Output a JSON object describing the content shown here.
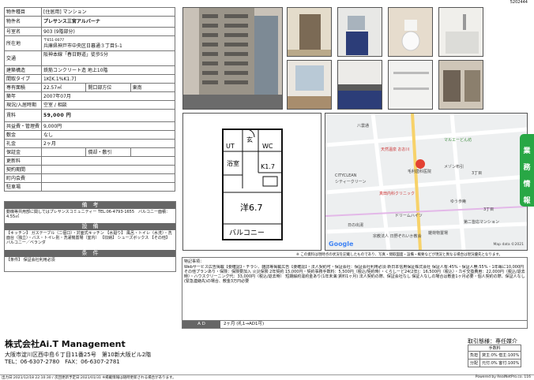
{
  "doc_id": "5202444",
  "spec": {
    "type_label": "物件種目",
    "type_value": "[住居用] マンション",
    "name_label": "物件名",
    "name_value": "プレサンス三宮アルバーナ",
    "room_label": "号室名",
    "room_value": "903 (9階部分)",
    "address_label": "所在地",
    "address_postal": "〒651-0077",
    "address_value": "兵庫県神戸市中央区日暮通３丁目5-1",
    "transport_label": "交通",
    "transport_value": "阪神本線「春日野道」徒歩5分",
    "structure_label": "建築構造",
    "structure_value": "鉄筋コンクリート造 地上10階",
    "layout_label": "間取タイプ",
    "layout_value": "1K[K.1%K1.7]",
    "area_label": "専有面積",
    "area_value": "22.57㎡",
    "direction_label": "開口部方位",
    "direction_value": "東南",
    "built_label": "築年",
    "built_value": "2007年07月",
    "status_label": "現況/入居時期",
    "status_value": "空室 / 相談",
    "rent_label": "賃料",
    "rent_value": "59,000 円",
    "fee_label": "共益費・管理費",
    "fee_value": "9,000円",
    "deposit_label": "敷金",
    "deposit_value": "なし",
    "key_money_label": "礼金",
    "key_money_value": "2ヶ月",
    "guarantee_label": "保証金",
    "guarantee_value": "",
    "amort_label": "償却・敷引",
    "amort_value": "",
    "renewal_label": "更新料",
    "renewal_value": "",
    "contract_label": "契約期間",
    "contract_value": "",
    "townfee_label": "町内会費",
    "townfee_value": "",
    "parking_label": "駐車場",
    "parking_value": ""
  },
  "remarks": {
    "title": "備　考",
    "text": "動機等共用部に関してはプレサンスコミュニティー TEL:06-4793-1655　バルコニー面積：4.55㎡"
  },
  "equipment": {
    "title": "設　備",
    "text": "【キッチン】 ガステーブル（二個口）・対面式キッチン 【水廻り】 風呂・トイレ（水洗）・洗面台（独立）・バス・トイレ別・洗濯機置場（室内） 【収納】 シューズボックス 【その他】 バルコニー／ベランダ"
  },
  "conditions": {
    "title": "条　件",
    "text": "【条件】 保証会社利用必須"
  },
  "floorplan": {
    "labels": [
      "玄",
      "UT",
      "WC",
      "浴室",
      "K1.7",
      "洋6.7",
      "バルコニー"
    ]
  },
  "map": {
    "labels": [
      "八雲通",
      "マルエーどん坊",
      "天然温泉 おお川",
      "メゾン布引",
      "3丁目",
      "CITYCLEAN",
      "シティークリーン",
      "毛利歯科医院",
      "真田内科クリニック",
      "ゆう歩庵",
      "第二皆応マンション",
      "ドリームハイツ",
      "日の出湯",
      "宗教法人 日野ぞれいか教会",
      "雑荷物置場",
      "3丁目",
      "Google",
      "Map data ©2021"
    ]
  },
  "map_note": "※ この資料は現時点の状況を記載したものであり、写真・間取図面・設備・概要などが現況と異なる場合は現況優先となります。",
  "special": {
    "label": "特記事項：",
    "text": "Webサービス広告掲載【要確認】・チラシ、雑誌等掲載広告【要確認】・法人契約可・保証会社：保証会社利用必須 新日本信用保証株式会社 保証人有:45%・保証人無:55%・1年毎に10,000円 その他プランあり・保険：保険要加入 火災保険 2年契約 15,000円・契約事務手数料：5,500円（税込/契約時）・くらしーど24(2年)：16,500円（税込）・カギ交換費用：22,000円（税込/退去時）・ハウスクリーニング代：33,000円（税込/退去時） 短期解約違約金あり(1年未満:賃料1ヶ月) 法人契約の際、保証会社なし 保証人なしの場合は敷金1ヶ月必要・個人契約の際、保証人なし(緊急連絡先)の場合、敷金3万円必要",
    "ad_label": "A D",
    "ad_value": "2ヶ月 (礼1→AD1可)"
  },
  "side_tab": [
    "業",
    "務",
    "情",
    "報"
  ],
  "company": {
    "name": "株式会社Ai.T Management",
    "address": "大阪市淀川区西中島６丁目11番25号　第10新大阪ビル2階",
    "phone": "TEL：06-6307-2780　FAX：06-6307-2781"
  },
  "deal": {
    "title": "取引態様：専任媒介",
    "fee_title": "手数料",
    "row1_label": "負担",
    "row1_value": "貸主:0% 借主:100%",
    "row2_label": "分配",
    "row2_value": "元付:0% 客付:100%"
  },
  "footer": {
    "left": "出力日:2021/12/18 22:10:30 / 次回更新予定日:2021/01/31 ※掲載情報は随時更新される場合があります。",
    "right": "Powered by RealNetPro.co. 116"
  }
}
